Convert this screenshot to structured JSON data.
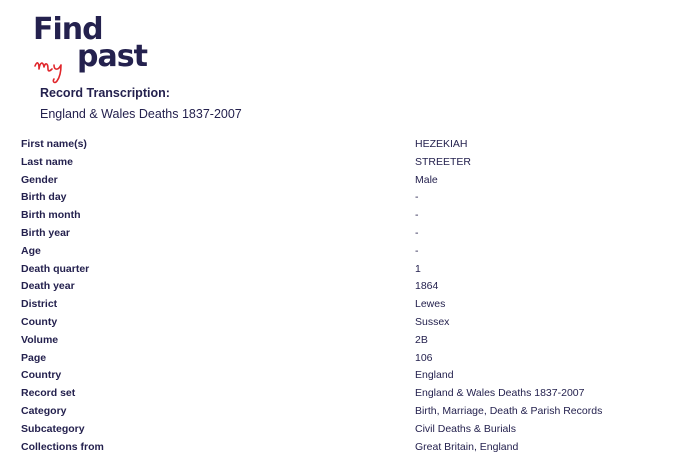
{
  "brand": {
    "find": "Find",
    "my": "my",
    "past": "past",
    "accent_color": "#e0262b",
    "text_color": "#24214e"
  },
  "header": {
    "title": "Record Transcription:",
    "subtitle": "England & Wales Deaths 1837-2007"
  },
  "fields": [
    {
      "label": "First name(s)",
      "value": "HEZEKIAH"
    },
    {
      "label": "Last name",
      "value": "STREETER"
    },
    {
      "label": "Gender",
      "value": "Male"
    },
    {
      "label": "Birth day",
      "value": "-"
    },
    {
      "label": "Birth month",
      "value": "-"
    },
    {
      "label": "Birth year",
      "value": "-"
    },
    {
      "label": "Age",
      "value": "-"
    },
    {
      "label": "Death quarter",
      "value": "1"
    },
    {
      "label": "Death year",
      "value": "1864"
    },
    {
      "label": "District",
      "value": "Lewes"
    },
    {
      "label": "County",
      "value": "Sussex"
    },
    {
      "label": "Volume",
      "value": "2B"
    },
    {
      "label": "Page",
      "value": "106"
    },
    {
      "label": "Country",
      "value": "England"
    },
    {
      "label": "Record set",
      "value": "England & Wales Deaths 1837-2007"
    },
    {
      "label": "Category",
      "value": "Birth, Marriage, Death & Parish Records"
    },
    {
      "label": "Subcategory",
      "value": "Civil Deaths & Burials"
    },
    {
      "label": "Collections from",
      "value": "Great Britain, England"
    }
  ]
}
